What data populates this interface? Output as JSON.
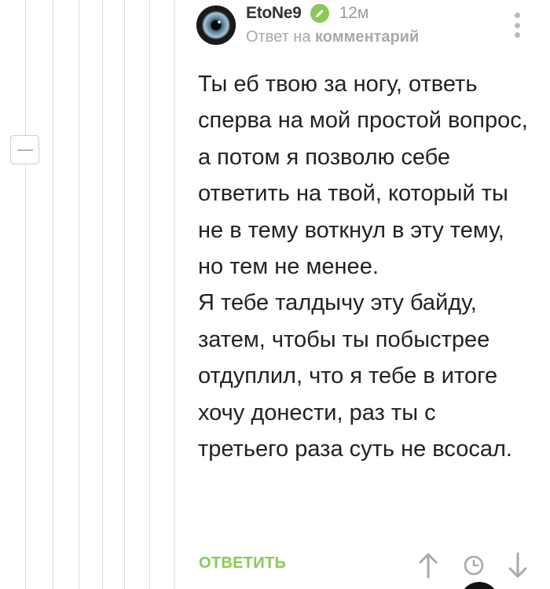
{
  "comment": {
    "author": "EtoNe9",
    "timestamp": "12м",
    "reply_prefix": "Ответ на",
    "reply_target": "комментарий",
    "body_paragraphs": [
      "Ты еб твою за ногу, ответь сперва на мой простой вопрос, а потом я позволю себе ответить на твой, который ты не в тему воткнул в эту тему, но тем не менее.",
      "Я тебе талдычу эту байду, затем, чтобы ты побыстрее отдуплил, что я тебе в итоге хочу донести, раз ты с третьего раза суть не всосал."
    ],
    "reply_label": "ОТВЕТИТЬ"
  },
  "icons": {
    "avatar": "avatar-eye",
    "verified": "pencil-icon",
    "menu": "kebab-menu-icon",
    "collapse": "minus-icon",
    "upvote": "arrow-up-icon",
    "later": "clock-icon",
    "downvote": "arrow-down-icon"
  },
  "colors": {
    "accent": "#8ac858",
    "text": "#222222",
    "muted": "#a8a8a8",
    "thread_line": "#dcdcdc"
  }
}
